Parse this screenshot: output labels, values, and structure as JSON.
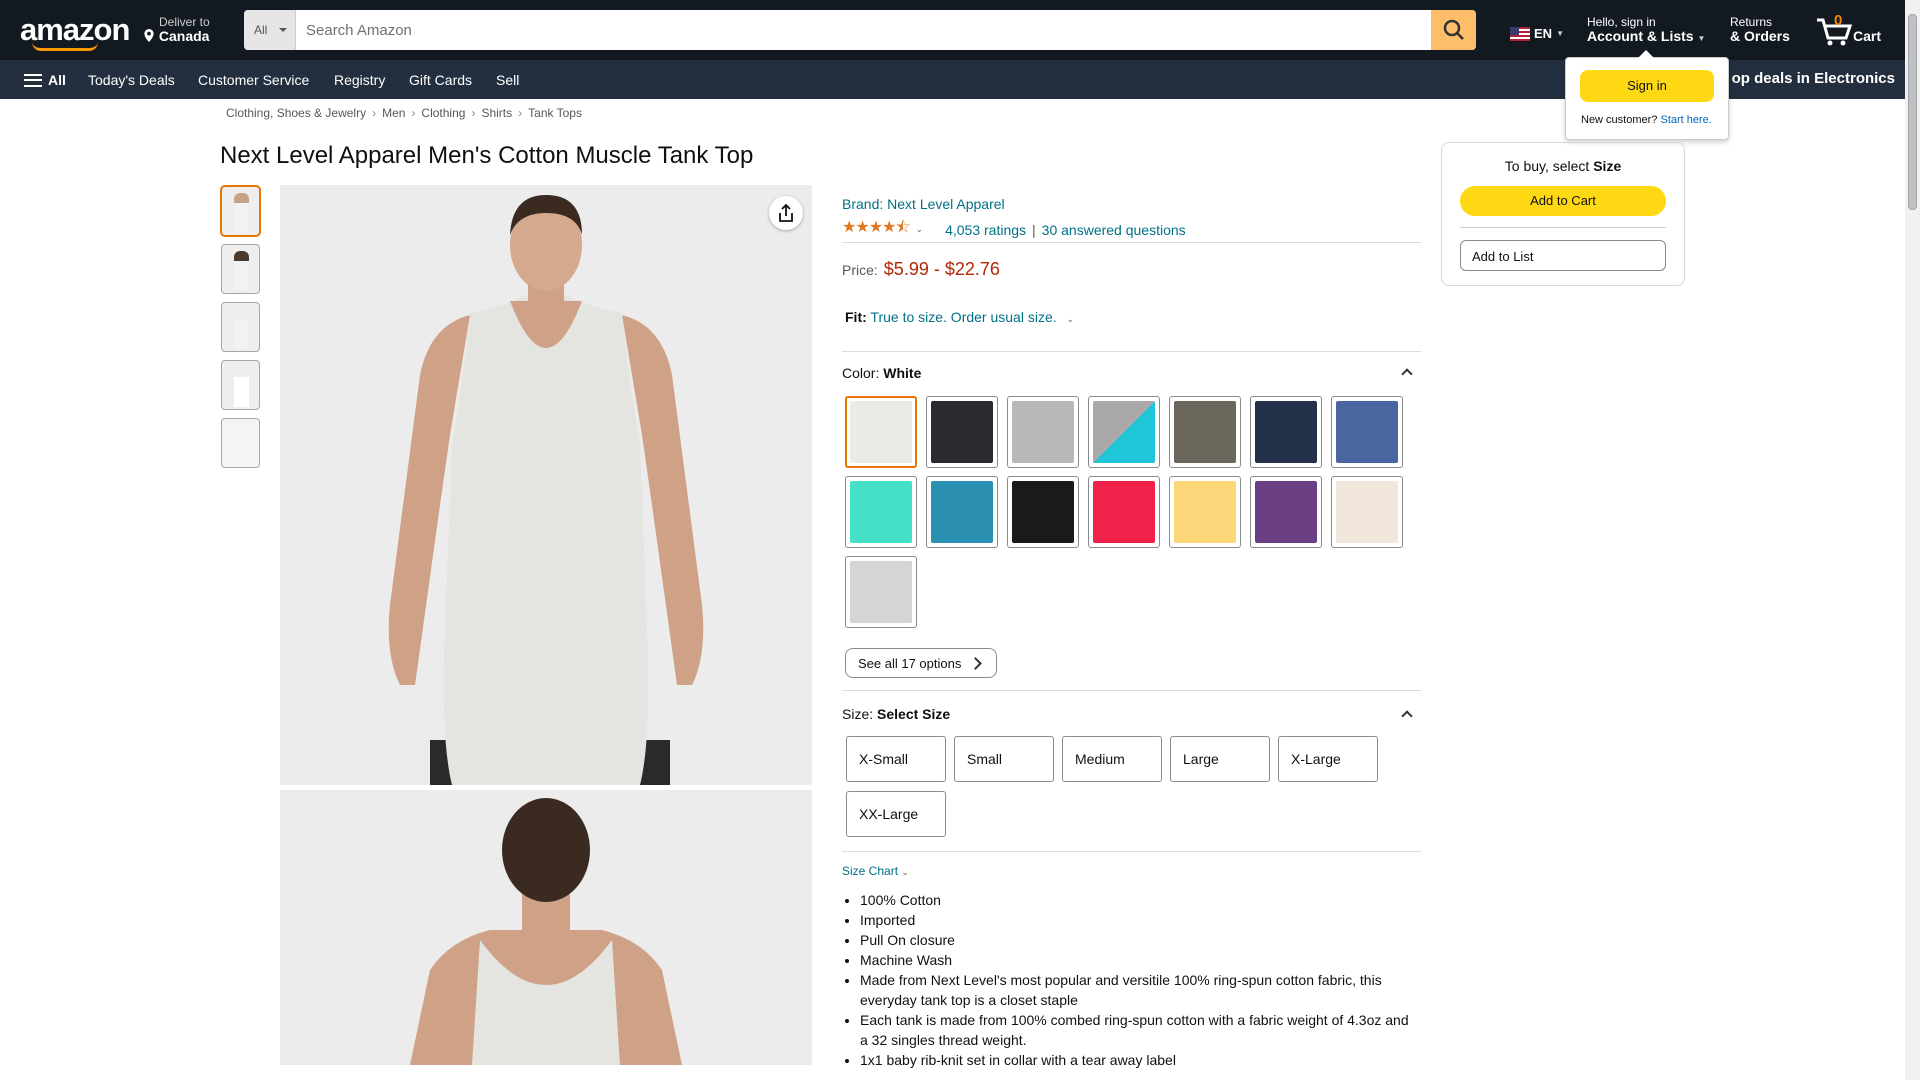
{
  "header": {
    "logo": "amazon",
    "deliver_label": "Deliver to",
    "deliver_location": "Canada",
    "search_category": "All",
    "search_placeholder": "Search Amazon",
    "language": "EN",
    "account_greeting": "Hello, sign in",
    "account_label": "Account & Lists",
    "returns_line1": "Returns",
    "returns_line2": "& Orders",
    "cart_count": "0",
    "cart_label": "Cart"
  },
  "nav": {
    "all_label": "All",
    "items": [
      "Today's Deals",
      "Customer Service",
      "Registry",
      "Gift Cards",
      "Sell"
    ],
    "promo": "op deals in Electronics"
  },
  "signin_popup": {
    "button": "Sign in",
    "new_customer": "New customer?",
    "start_here": "Start here."
  },
  "breadcrumb": [
    "Clothing, Shoes & Jewelry",
    "Men",
    "Clothing",
    "Shirts",
    "Tank Tops"
  ],
  "product": {
    "title": "Next Level Apparel Men's Cotton Muscle Tank Top",
    "brand": "Brand: Next Level Apparel",
    "stars": "★★★★⯪",
    "ratings": "4,053 ratings",
    "answered": "30 answered questions",
    "price_label": "Price:",
    "price": "$5.99 - $22.76",
    "fit_label": "Fit:",
    "fit_value": "True to size. Order usual size.",
    "color_label": "Color:",
    "color_value": "White",
    "swatch_colors": [
      "#eceae6",
      "#2a2a30",
      "#b8b8b8",
      "linear-gradient(135deg,#a8a8a8 50%,#1ec6d8 50%)",
      "#6b675c",
      "#23304a",
      "#4a66a0",
      "#44e0c8",
      "#2a8fb0",
      "#1a1a1a",
      "#f0224a",
      "#fdd67a",
      "#6a3f84",
      "#f0e6da",
      "#d6d4d6"
    ],
    "see_all": "See all 17 options",
    "size_label": "Size:",
    "size_value": "Select Size",
    "sizes": [
      "X-Small",
      "Small",
      "Medium",
      "Large",
      "X-Large",
      "XX-Large"
    ],
    "size_chart": "Size Chart",
    "bullets": [
      "100% Cotton",
      "Imported",
      "Pull On closure",
      "Machine Wash",
      "Made from Next Level's most popular and versitile 100% ring-spun cotton fabric, this everyday tank top is a closet staple",
      "Each tank is made from 100% combed ring-spun cotton with a fabric weight of 4.3oz and a 32 singles thread weight.",
      "1x1 baby rib-knit set in collar with a tear away label"
    ]
  },
  "buybox": {
    "prompt": "To buy, select",
    "prompt_bold": "Size",
    "add_to_cart": "Add to Cart",
    "add_to_list": "Add to List"
  }
}
